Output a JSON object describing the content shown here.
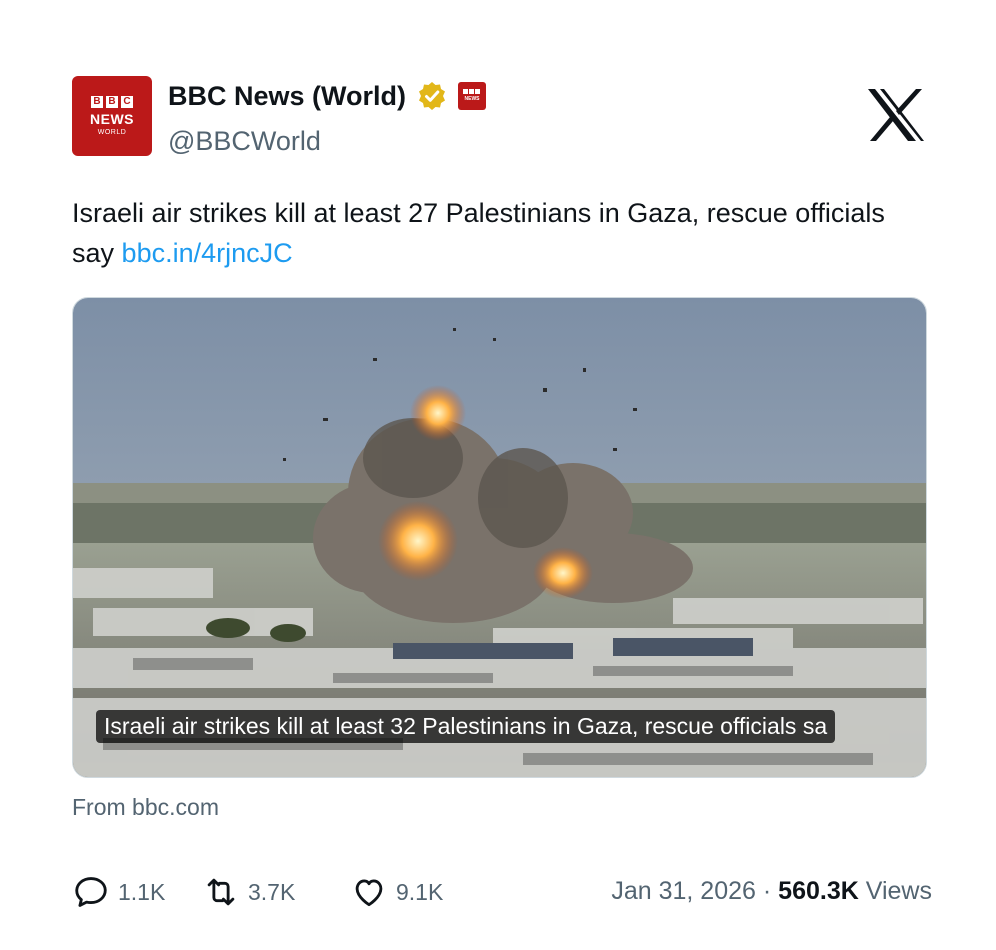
{
  "account": {
    "display_name": "BBC News (World)",
    "handle": "@BBCWorld",
    "avatar_letters": [
      "B",
      "B",
      "C"
    ],
    "avatar_line1": "NEWS",
    "avatar_line2": "WORLD",
    "badges": [
      "verified-gold-icon",
      "affiliation-bbc-icon"
    ]
  },
  "platform_logo": "x-logo-icon",
  "tweet": {
    "text": "Israeli air strikes kill at least 27 Palestinians in Gaza, rescue officials say",
    "link": "bbc.in/4rjncJC"
  },
  "card": {
    "caption": "Israeli air strikes kill at least 32 Palestinians in Gaza, rescue officials sa",
    "source": "From bbc.com"
  },
  "actions": {
    "replies": "1.1K",
    "reposts": "3.7K",
    "likes": "9.1K"
  },
  "meta": {
    "date": "Jan 31, 2026",
    "separator": "·",
    "views_count": "560.3K",
    "views_label": "Views"
  },
  "colors": {
    "bbc_red": "#bb1919",
    "link_blue": "#1d9bf0",
    "muted": "#536471",
    "verified_gold": "#e2b719"
  }
}
